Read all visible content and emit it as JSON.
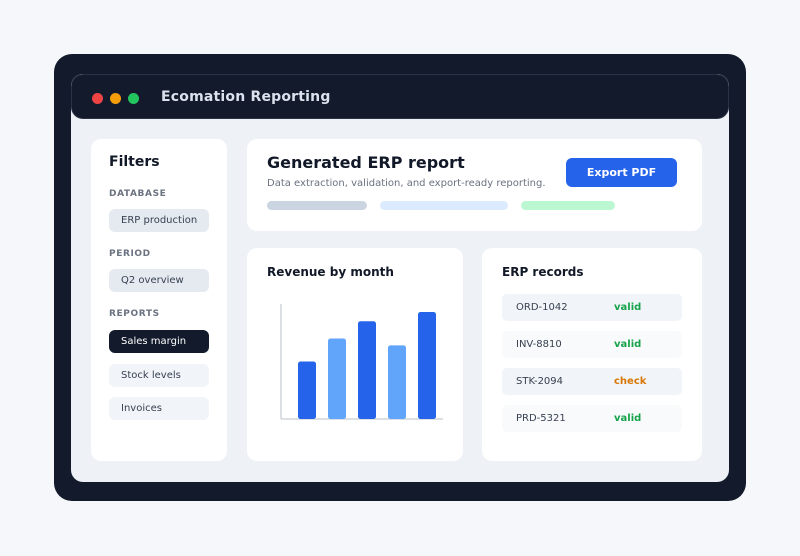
{
  "window": {
    "title": "Ecomation Reporting"
  },
  "sidebar": {
    "title": "Filters",
    "sections": [
      {
        "label": "DATABASE",
        "items": [
          "ERP production"
        ]
      },
      {
        "label": "PERIOD",
        "items": [
          "Q2 overview"
        ]
      },
      {
        "label": "REPORTS",
        "items": [
          "Sales margin",
          "Stock levels",
          "Invoices"
        ],
        "selected": "Sales margin"
      }
    ]
  },
  "report": {
    "title": "Generated ERP report",
    "subtitle": "Data extraction, validation, and export-ready reporting.",
    "export_label": "Export PDF"
  },
  "chart": {
    "title": "Revenue by month"
  },
  "chart_data": {
    "type": "bar",
    "categories": [
      "",
      "",
      "",
      "",
      ""
    ],
    "values": [
      50,
      70,
      85,
      64,
      93
    ],
    "colors": [
      "#2563eb",
      "#60a5fa",
      "#2563eb",
      "#60a5fa",
      "#2563eb"
    ],
    "ylim": [
      0,
      100
    ],
    "grid": false
  },
  "records": {
    "title": "ERP records",
    "rows": [
      {
        "id": "ORD-1042",
        "status": "valid"
      },
      {
        "id": "INV-8810",
        "status": "valid"
      },
      {
        "id": "STK-2094",
        "status": "check"
      },
      {
        "id": "PRD-5321",
        "status": "valid"
      }
    ]
  },
  "colors": {
    "accent": "#2563eb",
    "frame": "#121a2b",
    "valid": "#16a34a",
    "check": "#d97706"
  }
}
